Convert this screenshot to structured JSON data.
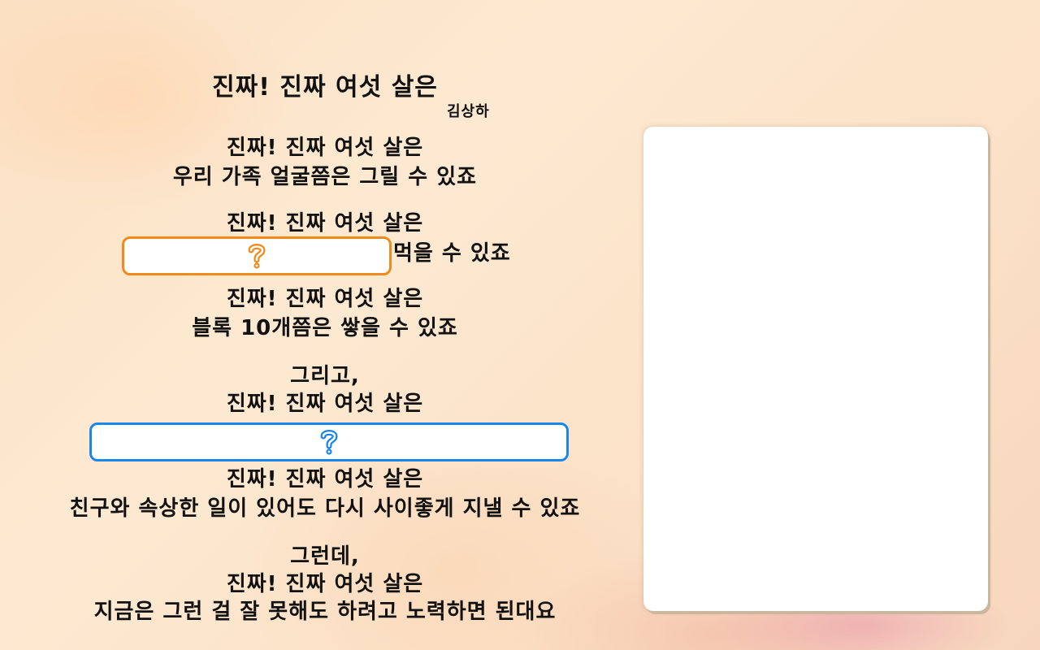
{
  "title": "진짜! 진짜 여섯 살은",
  "author": "김상하",
  "stanzas": [
    {
      "line1": "진짜! 진짜 여섯 살은",
      "line2": "우리 가족 얼굴쯤은 그릴 수 있죠"
    },
    {
      "line1": "진짜! 진짜 여섯 살은",
      "blank_hint": "?",
      "after_blank": "먹을 수 있죠"
    },
    {
      "line1": "진짜! 진짜 여섯 살은",
      "line2": "블록 10개쯤은 쌓을 수 있죠"
    },
    {
      "intro": "그리고,",
      "line1": "진짜! 진짜 여섯 살은",
      "blank_hint": "?"
    },
    {
      "line1": "진짜! 진짜 여섯 살은",
      "line2": "친구와 속상한 일이 있어도 다시 사이좋게 지낼 수 있죠"
    },
    {
      "intro": "그런데,",
      "line1": "진짜! 진짜 여섯 살은",
      "line2": "지금은 그런 걸 잘 못해도 하려고 노력하면 된대요"
    }
  ],
  "colors": {
    "blank_orange": "#f28a1b",
    "blank_blue": "#1a86e8",
    "text": "#111111"
  },
  "icons": {
    "blank_icon": "question-mark-icon"
  }
}
